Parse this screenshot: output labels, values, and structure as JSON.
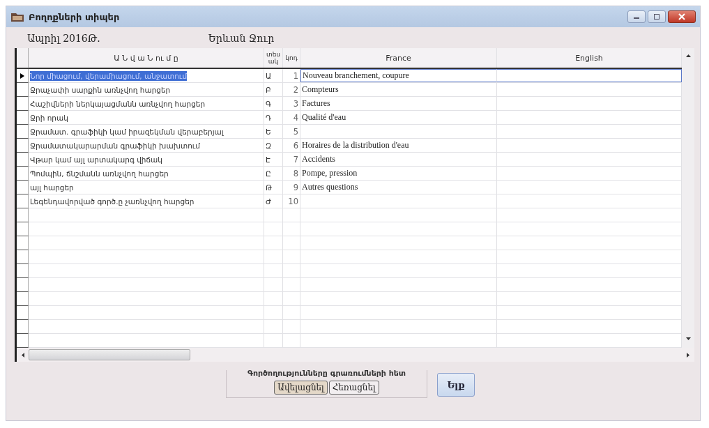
{
  "window": {
    "title": "Բողոքների տիպեր"
  },
  "header": {
    "period": "Ապրիլ 2016Թ.",
    "company": "Երևան Ջուր"
  },
  "table": {
    "columns": [
      {
        "label": "Ա Ն վ ա Ն ու մ ը"
      },
      {
        "label": "տես ակ"
      },
      {
        "label": "կոդ"
      },
      {
        "label": "France"
      },
      {
        "label": "English"
      }
    ],
    "rows": [
      {
        "name": "Նոր միացում, վերամիացում, անջատում",
        "type": "Ա",
        "code": "1",
        "france": "Nouveau branchement, coupure",
        "selected": true
      },
      {
        "name": "Ջրաչափի սարքին առնչվող հարցեր",
        "type": "Բ",
        "code": "2",
        "france": "Compteurs",
        "selected": false
      },
      {
        "name": "Հաշիվների ներկայացմանն առնչվող հարցեր",
        "type": "Գ",
        "code": "3",
        "france": "Factures",
        "selected": false
      },
      {
        "name": "Ջրի որակ",
        "type": "Դ",
        "code": "4",
        "france": "Qualité d'eau",
        "selected": false
      },
      {
        "name": "Ջրամատ. գրաֆիկի կամ իրազեկման վերաբերյալ",
        "type": "Ե",
        "code": "5",
        "selected": false
      },
      {
        "name": "Ջրամատակարարման գրաֆիկի խախտում",
        "type": "Զ",
        "code": "6",
        "france": "Horaires de la distribution d'eau",
        "selected": false
      },
      {
        "name": "Վթար կամ այլ արտակարգ վիճակ",
        "type": "Է",
        "code": "7",
        "france": "Accidents",
        "selected": false
      },
      {
        "name": "Պոմպին, ճնշմանն առնչվող հարցեր",
        "type": "Ը",
        "code": "8",
        "france": "Pompe, pression",
        "selected": false
      },
      {
        "name": "այլ հարցեր",
        "type": "Թ",
        "code": "9",
        "france": "Autres questions",
        "selected": false
      },
      {
        "name": "Լեգենդավորված գործ.ը չառնչվող հարցեր",
        "type": "Ժ",
        "code": "10",
        "selected": false
      }
    ]
  },
  "actions": {
    "title": "Գործողությունները գրառումների հետ",
    "buttons": [
      "Ավելացնել",
      "Հեռացնել"
    ]
  },
  "exit": "Ելք"
}
